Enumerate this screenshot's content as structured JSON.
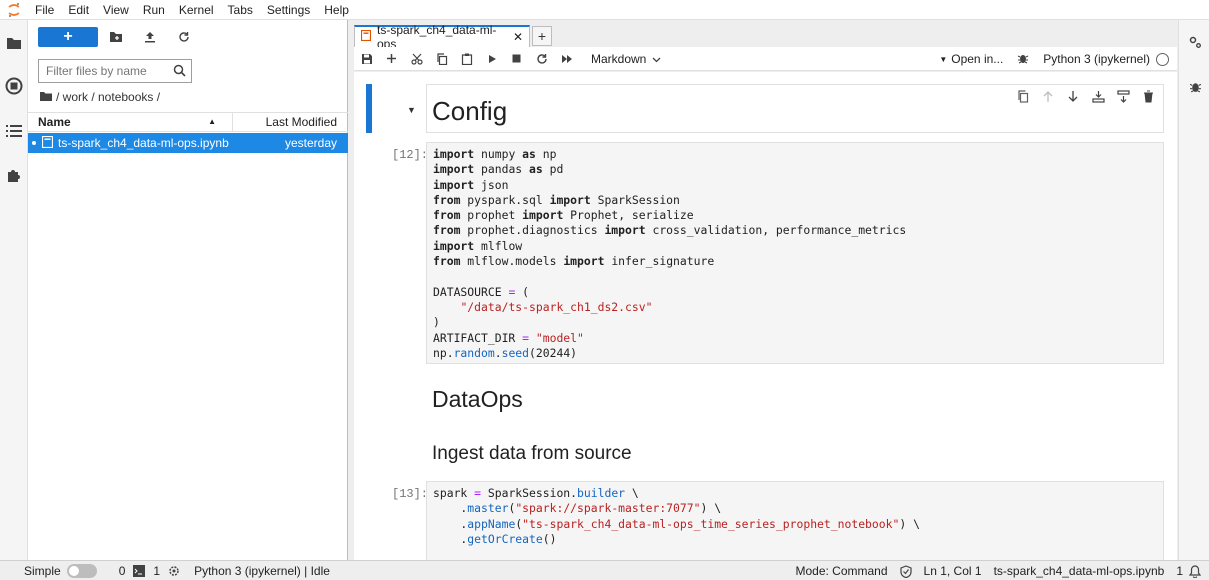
{
  "menubar": {
    "items": [
      "File",
      "Edit",
      "View",
      "Run",
      "Kernel",
      "Tabs",
      "Settings",
      "Help"
    ]
  },
  "filebrowser": {
    "new_label": "+",
    "filter_placeholder": "Filter files by name",
    "breadcrumb": "/ work / notebooks /",
    "col_name": "Name",
    "col_modified": "Last Modified",
    "files": [
      {
        "name": "ts-spark_ch4_data-ml-ops.ipynb",
        "modified": "yesterday"
      }
    ]
  },
  "notebook": {
    "tab_label": "ts-spark_ch4_data-ml-ops",
    "cell_type": "Markdown",
    "open_in": "Open in...",
    "kernel_name": "Python 3 (ipykernel)",
    "heading_config": "Config",
    "prompt_12": "[12]:",
    "heading_dataops": "DataOps",
    "heading_ingest": "Ingest data from source",
    "prompt_13": "[13]:"
  },
  "statusbar": {
    "mode_simple": "Simple",
    "terminals": "0",
    "kernels": "1",
    "kernel_status": "Python 3 (ipykernel) | Idle",
    "mode": "Mode: Command",
    "cursor": "Ln 1, Col 1",
    "file": "ts-spark_ch4_data-ml-ops.ipynb",
    "notifications": "1"
  },
  "colors": {
    "accent": "#1976d2",
    "selected_row": "#1e88e5",
    "string": "#ba2121"
  }
}
